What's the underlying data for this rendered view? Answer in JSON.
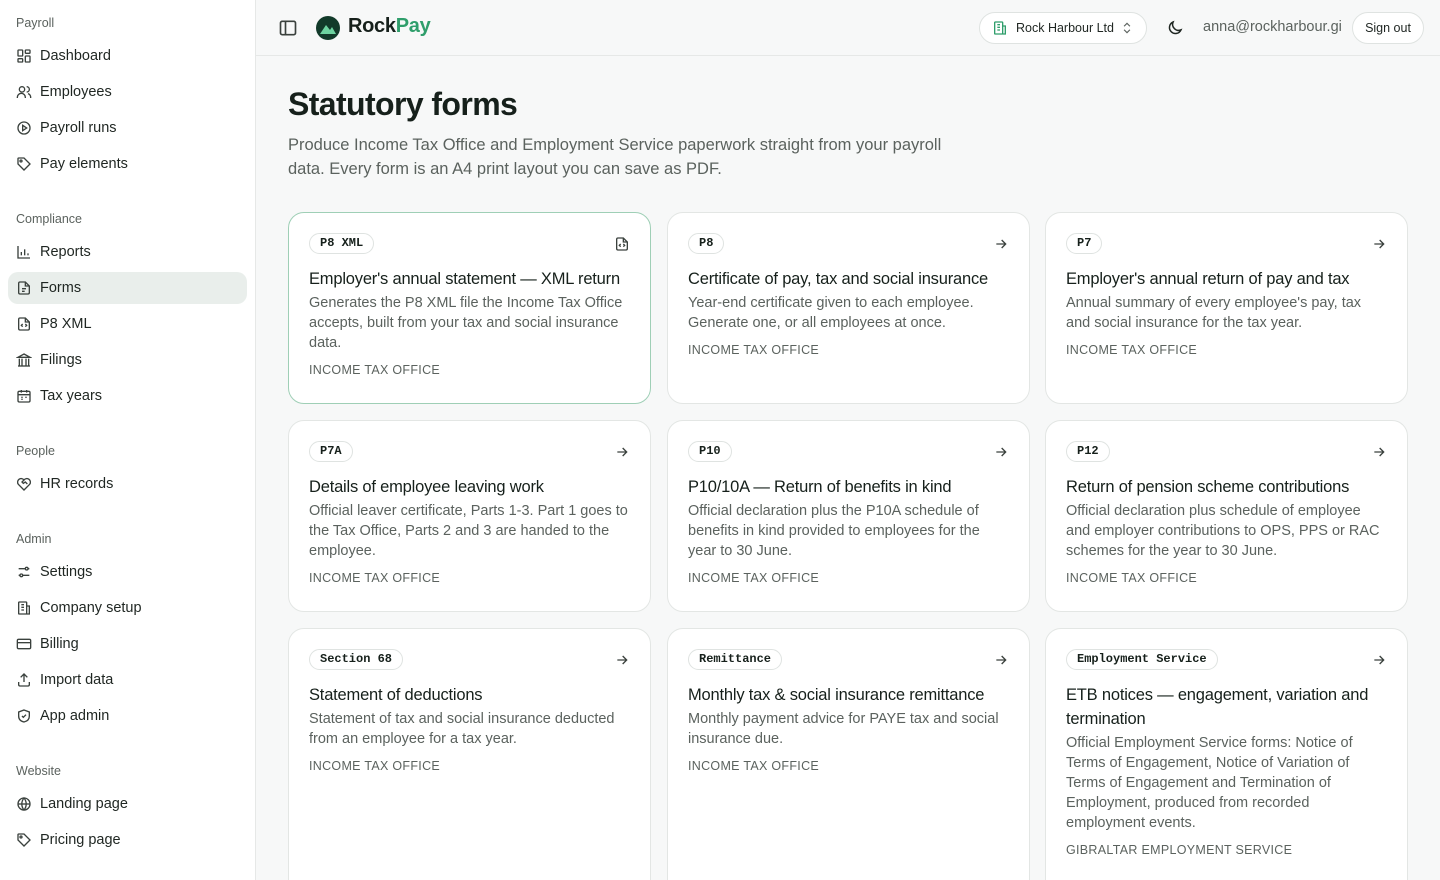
{
  "sidebar": {
    "groups": [
      {
        "label": "Payroll",
        "items": [
          {
            "label": "Dashboard",
            "icon": "dashboard-icon"
          },
          {
            "label": "Employees",
            "icon": "users-icon"
          },
          {
            "label": "Payroll runs",
            "icon": "play-circle-icon"
          },
          {
            "label": "Pay elements",
            "icon": "tags-icon"
          }
        ]
      },
      {
        "label": "Compliance",
        "items": [
          {
            "label": "Reports",
            "icon": "bar-chart-icon"
          },
          {
            "label": "Forms",
            "icon": "file-icon",
            "active": true
          },
          {
            "label": "P8 XML",
            "icon": "file-code-icon"
          },
          {
            "label": "Filings",
            "icon": "landmark-icon"
          },
          {
            "label": "Tax years",
            "icon": "calendar-icon"
          }
        ]
      },
      {
        "label": "People",
        "items": [
          {
            "label": "HR records",
            "icon": "heart-handshake-icon"
          }
        ]
      },
      {
        "label": "Admin",
        "items": [
          {
            "label": "Settings",
            "icon": "sliders-icon"
          },
          {
            "label": "Company setup",
            "icon": "building-icon"
          },
          {
            "label": "Billing",
            "icon": "credit-card-icon"
          },
          {
            "label": "Import data",
            "icon": "upload-icon"
          },
          {
            "label": "App admin",
            "icon": "shield-check-icon"
          }
        ]
      },
      {
        "label": "Website",
        "items": [
          {
            "label": "Landing page",
            "icon": "globe-icon"
          },
          {
            "label": "Pricing page",
            "icon": "tag-icon"
          }
        ]
      }
    ]
  },
  "topbar": {
    "logo_rock": "Rock",
    "logo_pay": "Pay",
    "company": "Rock Harbour Ltd",
    "user_email": "anna@rockharbour.gi",
    "sign_out": "Sign out"
  },
  "colors": {
    "accent": "#2f9e6b",
    "active_bg": "#e9eeeb",
    "selected_border": "#9fcfb6"
  },
  "page": {
    "title": "Statutory forms",
    "description": "Produce Income Tax Office and Employment Service paperwork straight from your payroll data. Every form is an A4 print layout you can save as PDF."
  },
  "cards": [
    {
      "badge": "P8 XML",
      "title": "Employer's annual statement — XML return",
      "desc": "Generates the P8 XML file the Income Tax Office accepts, built from your tax and social insurance data.",
      "source": "INCOME TAX OFFICE",
      "icon": "file-code-icon",
      "selected": true
    },
    {
      "badge": "P8",
      "title": "Certificate of pay, tax and social insurance",
      "desc": "Year-end certificate given to each employee. Generate one, or all employees at once.",
      "source": "INCOME TAX OFFICE",
      "icon": "arrow-right-icon"
    },
    {
      "badge": "P7",
      "title": "Employer's annual return of pay and tax",
      "desc": "Annual summary of every employee's pay, tax and social insurance for the tax year.",
      "source": "INCOME TAX OFFICE",
      "icon": "arrow-right-icon"
    },
    {
      "badge": "P7A",
      "title": "Details of employee leaving work",
      "desc": "Official leaver certificate, Parts 1-3. Part 1 goes to the Tax Office, Parts 2 and 3 are handed to the employee.",
      "source": "INCOME TAX OFFICE",
      "icon": "arrow-right-icon"
    },
    {
      "badge": "P10",
      "title": "P10/10A — Return of benefits in kind",
      "desc": "Official declaration plus the P10A schedule of benefits in kind provided to employees for the year to 30 June.",
      "source": "INCOME TAX OFFICE",
      "icon": "arrow-right-icon"
    },
    {
      "badge": "P12",
      "title": "Return of pension scheme contributions",
      "desc": "Official declaration plus schedule of employee and employer contributions to OPS, PPS or RAC schemes for the year to 30 June.",
      "source": "INCOME TAX OFFICE",
      "icon": "arrow-right-icon"
    },
    {
      "badge": "Section 68",
      "title": "Statement of deductions",
      "desc": "Statement of tax and social insurance deducted from an employee for a tax year.",
      "source": "INCOME TAX OFFICE",
      "icon": "arrow-right-icon"
    },
    {
      "badge": "Remittance",
      "title": "Monthly tax & social insurance remittance",
      "desc": "Monthly payment advice for PAYE tax and social insurance due.",
      "source": "INCOME TAX OFFICE",
      "icon": "arrow-right-icon"
    },
    {
      "badge": "Employment Service",
      "title": "ETB notices — engagement, variation and termination",
      "desc": "Official Employment Service forms: Notice of Terms of Engagement, Notice of Variation of Terms of Engagement and Termination of Employment, produced from recorded employment events.",
      "source": "GIBRALTAR EMPLOYMENT SERVICE",
      "icon": "arrow-right-icon"
    }
  ]
}
